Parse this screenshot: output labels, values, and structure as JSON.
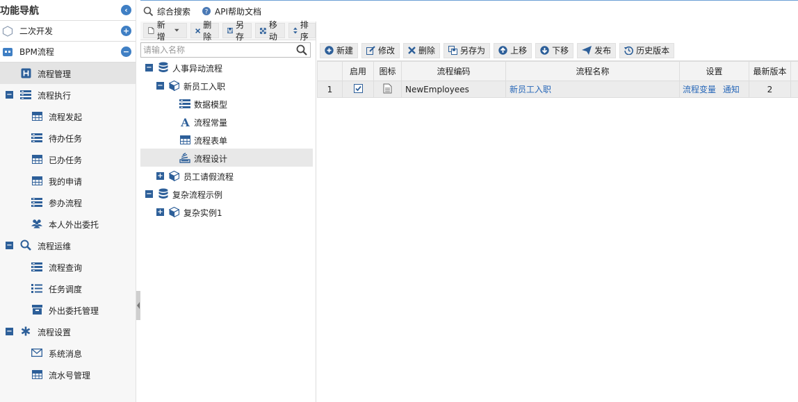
{
  "nav": {
    "title": "功能导航",
    "groups": [
      {
        "label": "二次开发",
        "icon": "hexagon-icon",
        "toggle": "+"
      },
      {
        "label": "BPM流程",
        "icon": "grid-icon",
        "toggle": "−"
      }
    ],
    "items": [
      {
        "label": "流程管理",
        "icon": "letter-h-icon",
        "level": 1,
        "selected": true
      },
      {
        "label": "流程执行",
        "icon": "list-icon",
        "level": 0,
        "toggle": "−"
      },
      {
        "label": "流程发起",
        "icon": "table-icon",
        "level": 2
      },
      {
        "label": "待办任务",
        "icon": "list-icon",
        "level": 2
      },
      {
        "label": "已办任务",
        "icon": "table-icon",
        "level": 2
      },
      {
        "label": "我的申请",
        "icon": "table-icon",
        "level": 2
      },
      {
        "label": "参办流程",
        "icon": "list-icon",
        "level": 2
      },
      {
        "label": "本人外出委托",
        "icon": "users-icon",
        "level": 2
      },
      {
        "label": "流程运维",
        "icon": "search-icon",
        "level": 0,
        "toggle": "−"
      },
      {
        "label": "流程查询",
        "icon": "list-icon",
        "level": 2
      },
      {
        "label": "任务调度",
        "icon": "bullet-list-icon",
        "level": 2
      },
      {
        "label": "外出委托管理",
        "icon": "archive-icon",
        "level": 2
      },
      {
        "label": "流程设置",
        "icon": "asterisk-icon",
        "level": 0,
        "toggle": "−"
      },
      {
        "label": "系统消息",
        "icon": "envelope-icon",
        "level": 2
      },
      {
        "label": "流水号管理",
        "icon": "table-icon",
        "level": 2
      }
    ]
  },
  "topbar": {
    "search_label": "综合搜索",
    "api_label": "API帮助文档"
  },
  "tree_toolbar": {
    "add_label": "新增",
    "delete_label": "删除",
    "saveas_label": "另存",
    "move_label": "移动",
    "sort_label": "排序"
  },
  "tree_search": {
    "placeholder": "请输入名称"
  },
  "tree": [
    {
      "label": "人事异动流程",
      "icon": "database-icon",
      "level": 0,
      "toggle": "−"
    },
    {
      "label": "新员工入职",
      "icon": "cube-icon",
      "level": 1,
      "toggle": "−"
    },
    {
      "label": "数据模型",
      "icon": "list-icon",
      "level": 2
    },
    {
      "label": "流程常量",
      "icon": "font-icon",
      "level": 2
    },
    {
      "label": "流程表单",
      "icon": "table-icon",
      "level": 2
    },
    {
      "label": "流程设计",
      "icon": "stack-icon",
      "level": 2,
      "selected": true
    },
    {
      "label": "员工请假流程",
      "icon": "cube-icon",
      "level": 1,
      "toggle": "+"
    },
    {
      "label": "复杂流程示例",
      "icon": "database-icon",
      "level": 0,
      "toggle": "−"
    },
    {
      "label": "复杂实例1",
      "icon": "cube-icon",
      "level": 1,
      "toggle": "+"
    }
  ],
  "grid_toolbar": {
    "new_label": "新建",
    "edit_label": "修改",
    "delete_label": "删除",
    "saveas_label": "另存为",
    "up_label": "上移",
    "down_label": "下移",
    "publish_label": "发布",
    "history_label": "历史版本"
  },
  "grid": {
    "columns": [
      "启用",
      "图标",
      "流程编码",
      "流程名称",
      "设置",
      "最新版本"
    ],
    "rows": [
      {
        "index": "1",
        "enabled": true,
        "code": "NewEmployees",
        "name": "新员工入职",
        "setting_var": "流程变量",
        "setting_notify": "通知",
        "version": "2"
      }
    ]
  },
  "colors": {
    "accent": "#3f7fc4",
    "toggle": "#2d5f99",
    "link": "#2767b8"
  }
}
